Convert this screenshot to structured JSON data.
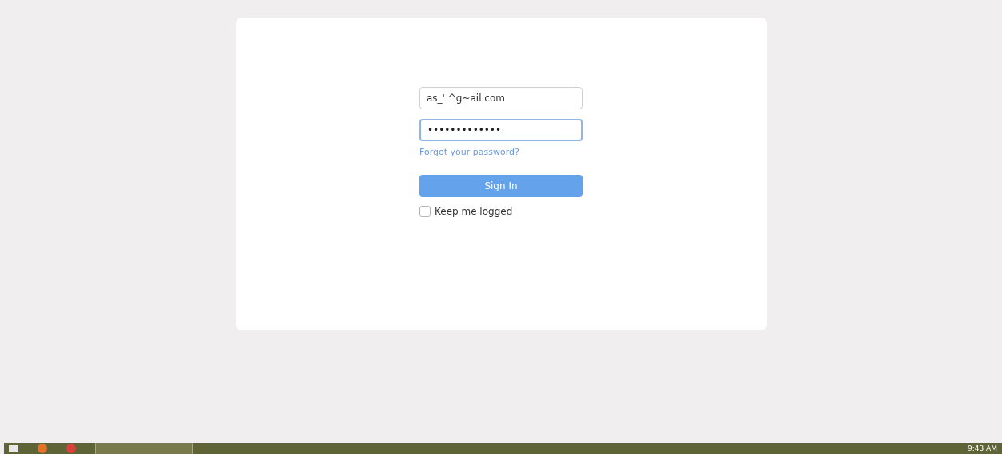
{
  "login": {
    "email": {
      "value": "as_' ^g~ail.com"
    },
    "password": {
      "value": "•••••••••••••",
      "focused": true
    },
    "forgot_link": "Forgot your password?",
    "sign_in_button": "Sign In",
    "keep_logged": {
      "label": "Keep me logged",
      "checked": false
    }
  },
  "taskbar": {
    "clock": "9:43 AM"
  }
}
